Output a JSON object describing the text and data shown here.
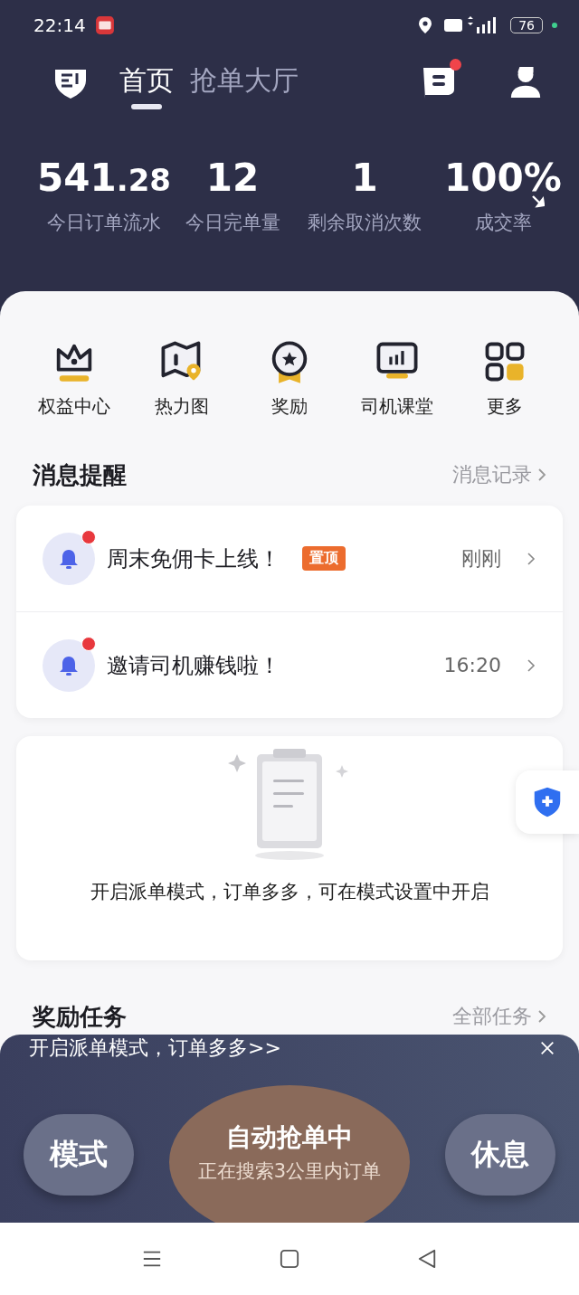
{
  "status_bar": {
    "time": "22:14",
    "battery": "76"
  },
  "tabs": [
    {
      "label": "首页",
      "selected": true
    },
    {
      "label": "抢单大厅",
      "selected": false
    }
  ],
  "header": {
    "message_unread": true
  },
  "stats": [
    {
      "value": "541",
      "fraction": ".28",
      "label": "今日订单流水"
    },
    {
      "value": "12",
      "label": "今日完单量"
    },
    {
      "value": "1",
      "label": "剩余取消次数"
    },
    {
      "value": "100%",
      "label": "成交率"
    }
  ],
  "shortcuts": [
    {
      "label": "权益中心",
      "kind": "crown"
    },
    {
      "label": "热力图",
      "kind": "map"
    },
    {
      "label": "奖励",
      "kind": "medal"
    },
    {
      "label": "司机课堂",
      "kind": "screen"
    },
    {
      "label": "更多",
      "kind": "grid"
    }
  ],
  "messages": {
    "title": "消息提醒",
    "link": "消息记录",
    "items": [
      {
        "title": "周末免佣卡上线！",
        "tag": "置顶",
        "time": "刚刚",
        "unread": true
      },
      {
        "title": "邀请司机赚钱啦！",
        "time": "16:20",
        "unread": true
      }
    ]
  },
  "empty_card": {
    "text": "开启派单模式，订单多多，可在模式设置中开启"
  },
  "tasks": {
    "title": "奖励任务",
    "link": "全部任务"
  },
  "bottom_panel": {
    "banner": "开启派单模式，订单多多>>",
    "mode_button": "模式",
    "main_title": "自动抢单中",
    "main_subtitle": "正在搜索3公里内订单",
    "rest_button": "休息"
  }
}
